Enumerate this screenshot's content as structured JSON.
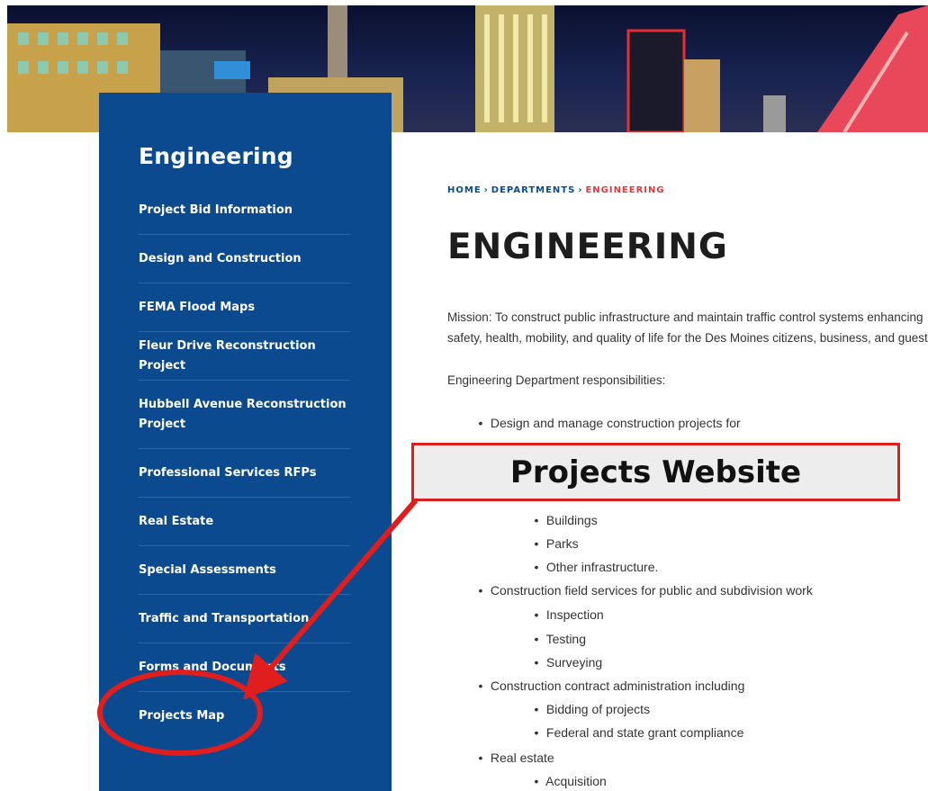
{
  "sidebar": {
    "title": "Engineering",
    "items": [
      {
        "label": "Project Bid Information"
      },
      {
        "label": "Design and Construction"
      },
      {
        "label": "FEMA Flood Maps"
      },
      {
        "label": "Fleur Drive Reconstruction Project"
      },
      {
        "label": "Hubbell Avenue Reconstruction Project"
      },
      {
        "label": "Professional Services RFPs"
      },
      {
        "label": "Real Estate"
      },
      {
        "label": "Special Assessments"
      },
      {
        "label": "Traffic and Transportation"
      },
      {
        "label": "Forms and Documents"
      },
      {
        "label": "Projects Map"
      }
    ]
  },
  "breadcrumb": [
    "HOME",
    "DEPARTMENTS",
    "ENGINEERING"
  ],
  "breadcrumb_sep": "›",
  "page_title": "ENGINEERING",
  "mission": "Mission: To construct public infrastructure and maintain traffic control systems enhancing safety, health, mobility, and quality of life for the Des Moines citizens, business, and guests.",
  "responsibilities_heading": "Engineering Department responsibilities:",
  "responsibilities": {
    "design": "Design and manage construction projects for",
    "buildings": "Buildings",
    "parks": "Parks",
    "other": "Other infrastructure.",
    "field": "Construction field services for public and subdivision work",
    "inspection": "Inspection",
    "testing": "Testing",
    "surveying": "Surveying",
    "contract": "Construction contract administration including",
    "bidding": "Bidding of projects",
    "grant": "Federal and state grant compliance",
    "real_estate": "Real estate",
    "acquisition": "Acquisition"
  },
  "bullet": "•",
  "callout": {
    "label": "Projects Website",
    "color": "#e01e1e"
  },
  "colors": {
    "sidebar_bg": "#0b4a8f",
    "breadcrumb_active": "#e03a3e",
    "annotation": "#e01e1e"
  }
}
